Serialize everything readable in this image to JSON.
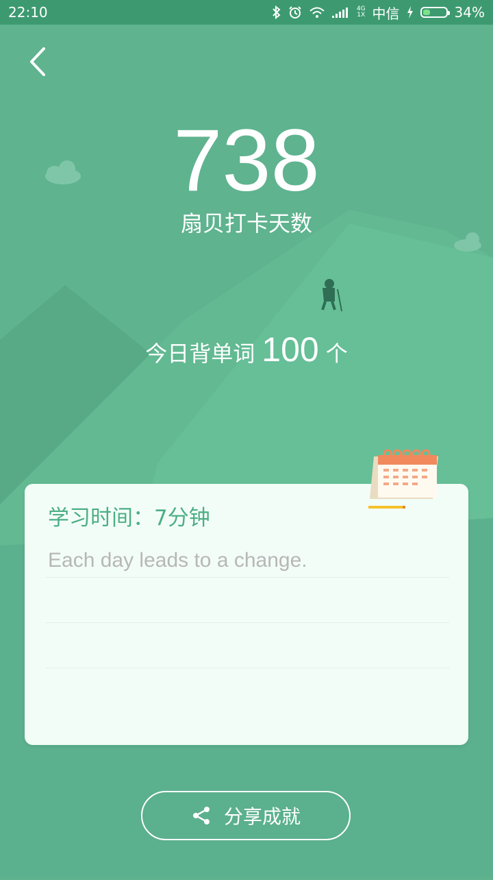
{
  "status_bar": {
    "time": "22:10",
    "network_small_top": "4G",
    "network_small_bottom": "1X",
    "carrier": "中信",
    "battery_text": "34%",
    "battery_level": 0.34,
    "icons": [
      "bluetooth-icon",
      "alarm-icon",
      "wifi-icon",
      "signal-icon",
      "charging-icon",
      "battery-icon"
    ]
  },
  "header": {
    "back_icon": "back-chevron-icon"
  },
  "checkin": {
    "days": "738",
    "caption": "扇贝打卡天数"
  },
  "today": {
    "prefix": "今日背单词",
    "count": "100",
    "unit": "个"
  },
  "card": {
    "study_time": "学习时间：7分钟",
    "quote": "Each day leads to a change.",
    "icon": "calendar-icon"
  },
  "share": {
    "label": "分享成就",
    "icon": "share-icon"
  },
  "colors": {
    "background": "#5fb38f",
    "status_bar": "#3d9a70",
    "accent_text": "#4cae84",
    "quote_text": "#b7b7b7",
    "card": "#f3fdf8"
  }
}
